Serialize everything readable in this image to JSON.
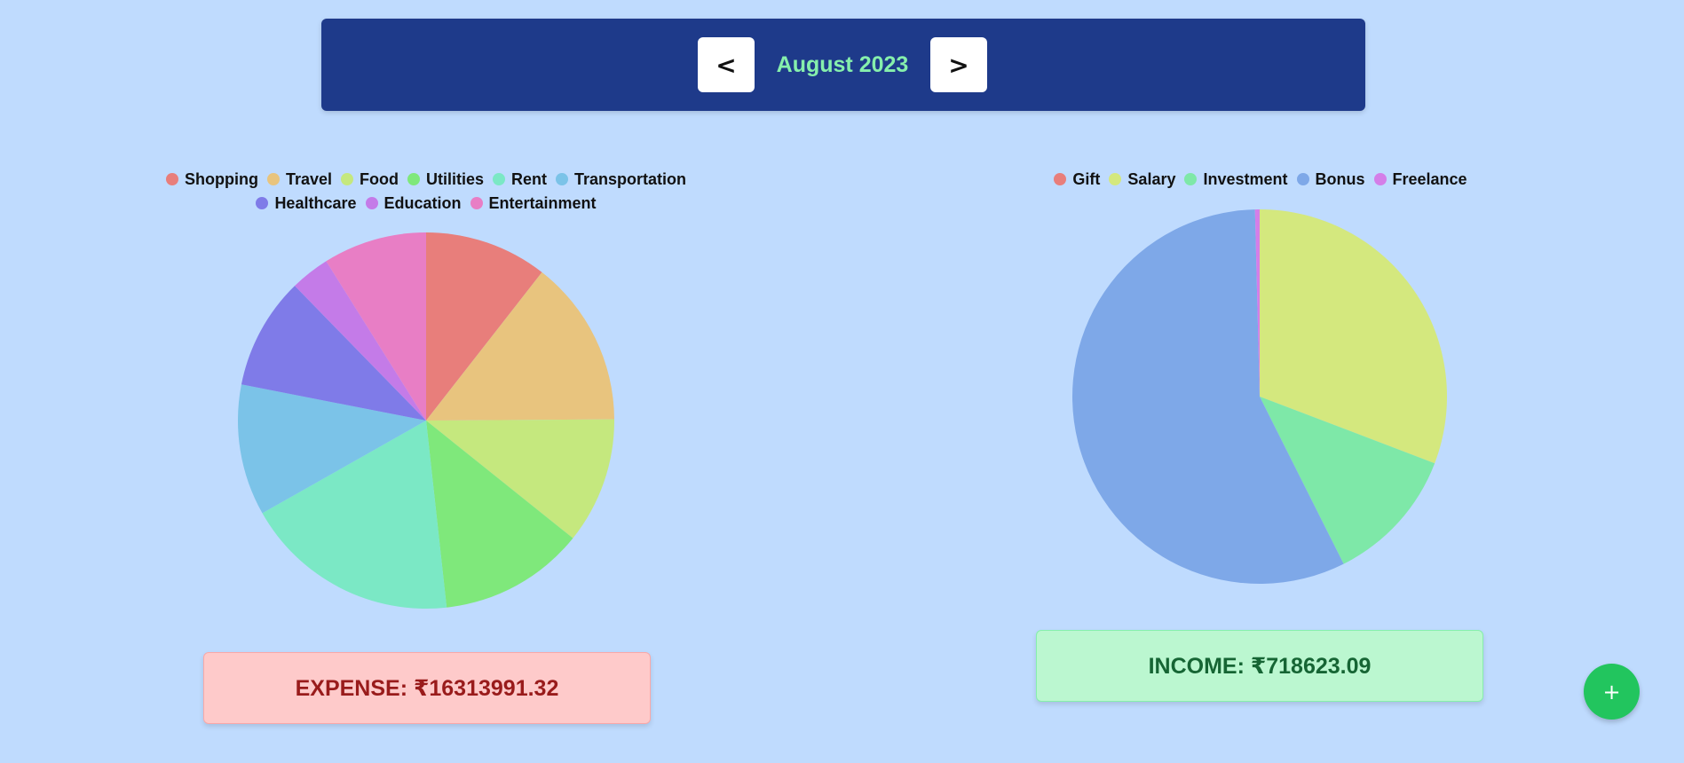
{
  "header": {
    "prev_label": "<",
    "month_label": "August 2023",
    "next_label": ">"
  },
  "summary": {
    "expense_text": "EXPENSE: ₹16313991.32",
    "income_text": "INCOME: ₹718623.09"
  },
  "fab_label": "+",
  "chart_data": [
    {
      "type": "pie",
      "labels": [
        "Shopping",
        "Travel",
        "Food",
        "Utilities",
        "Rent",
        "Transportation",
        "Healthcare",
        "Education",
        "Entertainment"
      ],
      "values": [
        10.3,
        14.0,
        10.6,
        12.2,
        18.1,
        11.0,
        9.4,
        3.3,
        8.7
      ],
      "colors": [
        "#e87e7b",
        "#e8c47e",
        "#c5e87e",
        "#7fe87b",
        "#7be8c5",
        "#7bc3e8",
        "#7f7be8",
        "#c47be8",
        "#e87ec5"
      ],
      "legend": "top"
    },
    {
      "type": "pie",
      "labels": [
        "Gift",
        "Salary",
        "Investment",
        "Bonus",
        "Freelance"
      ],
      "values": [
        0.0,
        30.8,
        11.8,
        57.0,
        0.4
      ],
      "colors": [
        "#e87e7b",
        "#d4e87e",
        "#7ee8a8",
        "#7ea8e8",
        "#d47ee8"
      ],
      "legend": "top"
    }
  ]
}
